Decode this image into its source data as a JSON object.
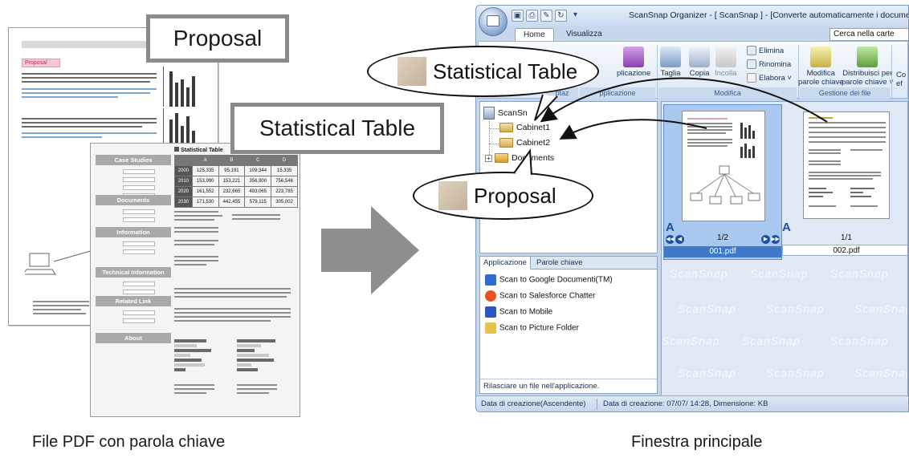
{
  "captions": {
    "left": "File PDF con parola chiave",
    "right": "Finestra principale"
  },
  "labels": {
    "proposal": "Proposal",
    "statistical_table": "Statistical Table"
  },
  "pdf_back": {
    "tag": "Proposal"
  },
  "pdf_front": {
    "table_title": "Statistical Table",
    "table_header": [
      "",
      "A",
      "B",
      "C",
      "D"
    ],
    "table_rows": [
      [
        "2000",
        "125,335",
        "95,191",
        "109,344",
        "15,335"
      ],
      [
        "2010",
        "153,990",
        "153,221",
        "356,900",
        "756,546"
      ],
      [
        "2020",
        "161,552",
        "232,665",
        "493,065",
        "223,785"
      ],
      [
        "2030",
        "171,530",
        "442,455",
        "579,115",
        "305,002"
      ]
    ],
    "sections": [
      "Case Studies",
      "Documents",
      "Information",
      "Technical Information",
      "Related Link",
      "About"
    ]
  },
  "window": {
    "title": "ScanSnap Organizer - [ ScanSnap ] - [Converte automaticamente i documenti PDF aggiun",
    "tabs": [
      "Home",
      "Visualizza"
    ],
    "search_caption": "Cerca nella carte",
    "ribbon": {
      "applicazione": "plicazione",
      "taglia": "Taglia",
      "copia": "Copia",
      "incolla": "Incolla",
      "elimina": "Elimina",
      "rinomina": "Rinomina",
      "elabora": "Elabora ˅",
      "modifica_parole": "Modifica",
      "modifica_parole_2": "parole chiave",
      "distribuisci": "Distribuisci per",
      "distribuisci_2": "parole chiave ˅",
      "cut_right_1": "Co",
      "cut_right_2": "ef",
      "group_pplicazione": "pplicazione",
      "group_modifica": "Modifica",
      "group_gestione": "Gestione dei file",
      "group_left_cut": "ptaz"
    },
    "tree": {
      "root": "ScanSn",
      "items": [
        "Cabinet1",
        "Cabinet2",
        "Documents"
      ]
    },
    "thumbs": [
      {
        "page": "1/2",
        "name": "001.pdf",
        "mark": "A"
      },
      {
        "page": "1/1",
        "name": "002.pdf",
        "mark": "A"
      }
    ],
    "app_tabs": [
      "Applicazione",
      "Parole chiave"
    ],
    "apps": [
      {
        "label": "Scan to Google Documenti(TM)",
        "color": "#2f6bd1"
      },
      {
        "label": "Scan to Salesforce Chatter",
        "color": "#e8501e"
      },
      {
        "label": "Scan to Mobile",
        "color": "#2a58c2"
      },
      {
        "label": "Scan to Picture Folder",
        "color": "#e7c24a"
      }
    ],
    "app_hint": "Rilasciare un file nell'applicazione.",
    "status": {
      "sort": "Data di creazione(Ascendente)",
      "detail": "Data di creazione: 07/07/        14:28, Dimensione:        KB"
    },
    "watermark": "ScanSnap"
  }
}
